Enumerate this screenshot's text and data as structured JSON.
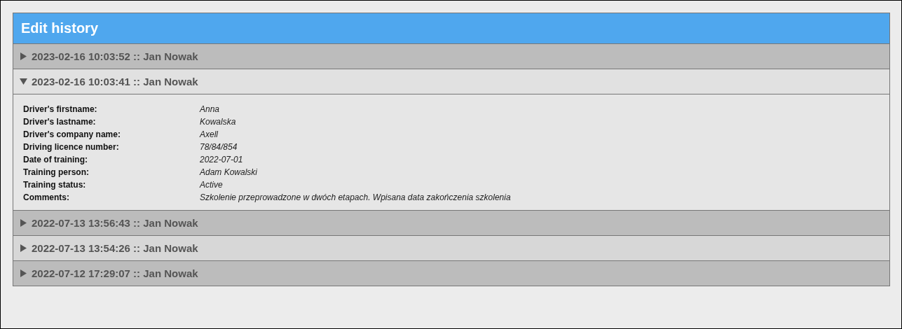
{
  "panel": {
    "title": "Edit history"
  },
  "entries": [
    {
      "title": "2023-02-16 10:03:52 :: Jan Nowak",
      "expanded": false
    },
    {
      "title": "2023-02-16 10:03:41 :: Jan Nowak",
      "expanded": true,
      "details": [
        {
          "label": "Driver's firstname:",
          "value": "Anna"
        },
        {
          "label": "Driver's lastname:",
          "value": "Kowalska"
        },
        {
          "label": "Driver's company name:",
          "value": "Axell"
        },
        {
          "label": "Driving licence number:",
          "value": "78/84/854"
        },
        {
          "label": "Date of training:",
          "value": "2022-07-01"
        },
        {
          "label": "Training person:",
          "value": "Adam Kowalski"
        },
        {
          "label": "Training status:",
          "value": "Active"
        },
        {
          "label": "Comments:",
          "value": "Szkolenie przeprowadzone w dwóch etapach. Wpisana data zakończenia szkolenia"
        }
      ]
    },
    {
      "title": "2022-07-13 13:56:43 :: Jan Nowak",
      "expanded": false
    },
    {
      "title": "2022-07-13 13:54:26 :: Jan Nowak",
      "expanded": false
    },
    {
      "title": "2022-07-12 17:29:07 :: Jan Nowak",
      "expanded": false
    }
  ]
}
